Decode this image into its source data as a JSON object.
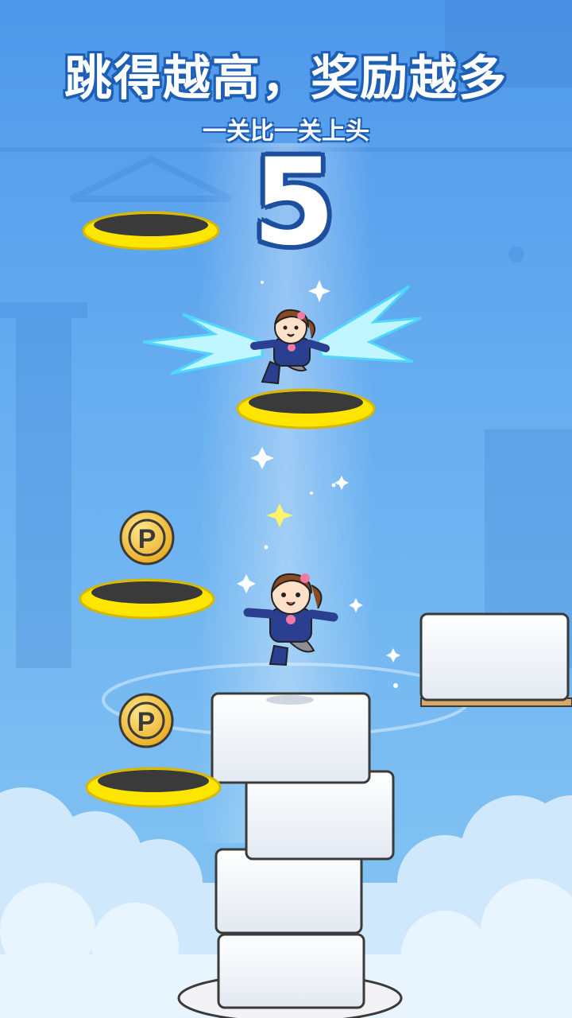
{
  "header": {
    "title": "跳得越高，奖励越多",
    "subtitle": "一关比一关上头"
  },
  "game": {
    "score": "5",
    "coin_symbol": "P",
    "coin_count": 2,
    "rings_count": 4,
    "characters_count": 2
  },
  "colors": {
    "sky_top": "#4f98ea",
    "sky_bottom": "#86c6f2",
    "ring_yellow": "#ffe600",
    "ring_hole": "#3a3a3a",
    "coin_gold": "#f5c542",
    "block_white": "#f6f8fb",
    "title_stroke": "#1e5fb6",
    "bolt_cyan": "#7fe7ff",
    "uniform_navy": "#2a3f8f",
    "skirt_gray": "#8e8e99",
    "hair_brown": "#8a4a22",
    "ribbon_pink": "#f07aa5"
  },
  "icons": {
    "coin": "p-coin-icon",
    "star": "sparkle-star-icon",
    "lightning": "lightning-burst-icon"
  }
}
